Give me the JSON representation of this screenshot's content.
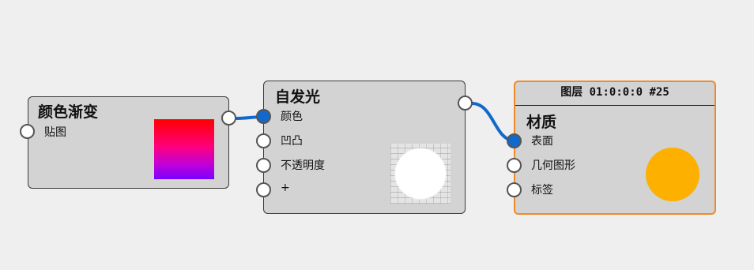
{
  "nodes": {
    "gradient": {
      "title": "颜色渐变",
      "inputs": [
        "贴图"
      ]
    },
    "emission": {
      "title": "自发光",
      "inputs": [
        "颜色",
        "凹凸",
        "不透明度",
        "+"
      ]
    },
    "material": {
      "header": "图层 01:0:0:0 #25",
      "title": "材质",
      "inputs": [
        "表面",
        "几何图形",
        "标签"
      ],
      "preview_color": "#fdb000"
    }
  },
  "colors": {
    "wire": "#1269cc",
    "selected_border": "#ee8a2c",
    "canvas": "#efefef"
  }
}
